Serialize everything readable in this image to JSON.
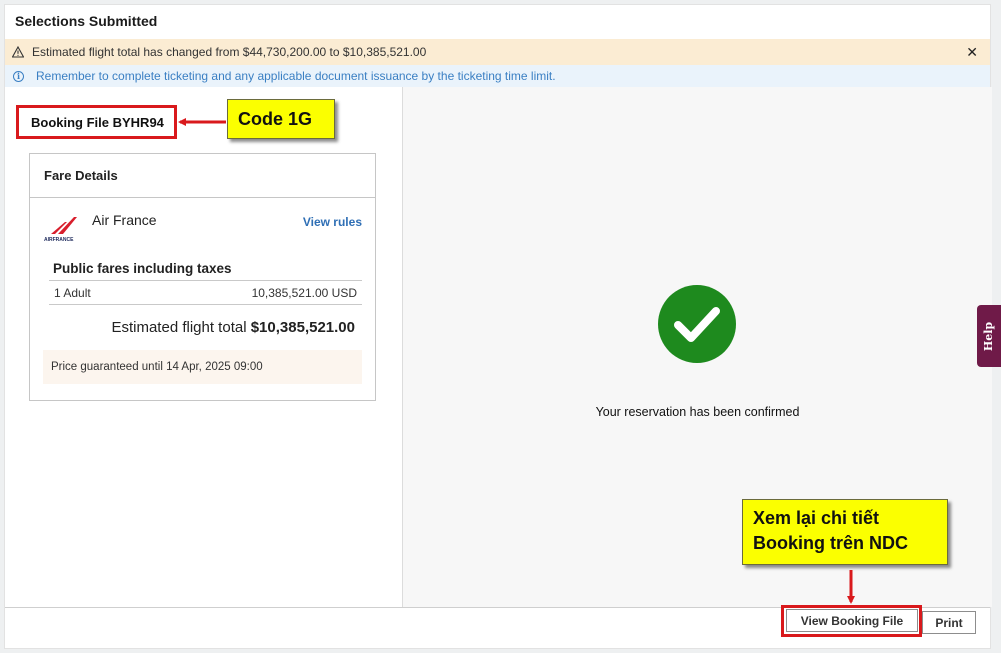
{
  "header": {
    "title": "Selections Submitted"
  },
  "alerts": {
    "warning": "Estimated flight total has changed from $44,730,200.00 to $10,385,521.00",
    "close_symbol": "✕",
    "info": "Remember to complete ticketing and any applicable document issuance by the ticketing time limit.",
    "info_symbol": "i"
  },
  "booking": {
    "label": "Booking File BYHR94"
  },
  "annotations": {
    "code_1g": "Code 1G",
    "ndc_line1": "Xem lại chi tiết",
    "ndc_line2": "Booking trên NDC"
  },
  "fare_details": {
    "title": "Fare Details",
    "airline": "Air France",
    "airline_logo_text": "AIRFRANCE",
    "view_rules": "View rules",
    "fares_heading": "Public fares including taxes",
    "passenger": "1 Adult",
    "passenger_amount": "10,385,521.00 USD",
    "total_label": "Estimated flight total",
    "total_value": "$10,385,521.00",
    "guarantee": "Price guaranteed until 14 Apr, 2025 09:00"
  },
  "confirmation": {
    "message": "Your reservation has been confirmed"
  },
  "buttons": {
    "view_booking": "View Booking File",
    "print": "Print"
  },
  "help": {
    "label": "Help"
  },
  "colors": {
    "highlight_red": "#d9191c",
    "callout_yellow": "#fbff00",
    "success_green": "#1e8a1e",
    "link_blue": "#2f6fb5",
    "help_purple": "#6f1a48"
  }
}
